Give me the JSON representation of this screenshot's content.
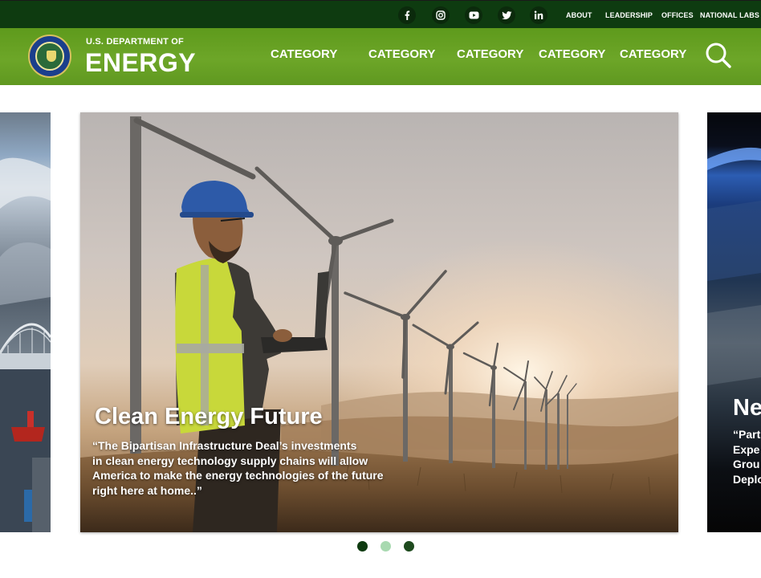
{
  "topbar": {
    "social": [
      {
        "name": "facebook-icon",
        "label": "f"
      },
      {
        "name": "instagram-icon",
        "label": ""
      },
      {
        "name": "youtube-icon",
        "label": ""
      },
      {
        "name": "twitter-icon",
        "label": ""
      },
      {
        "name": "linkedin-icon",
        "label": "in"
      }
    ],
    "links": [
      "ABOUT",
      "LEADERSHIP",
      "OFFICES",
      "NATIONAL LABS"
    ]
  },
  "header": {
    "brand_small": "U.S. DEPARTMENT OF",
    "brand_big": "ENERGY",
    "nav": [
      "CATEGORY",
      "CATEGORY",
      "CATEGORY",
      "CATEGORY",
      "CATEGORY"
    ]
  },
  "carousel": {
    "main": {
      "title": "Clean Energy Future",
      "quote_lines": [
        "“The Bipartisan Infrastructure Deal’s investments",
        " in clean energy technology supply chains will allow",
        "America to make the energy technologies of the future",
        " right here at home..”"
      ]
    },
    "next_peek": {
      "title": "Ne",
      "lines": [
        "“Part",
        "Expe",
        "Grou",
        "Deplo"
      ]
    },
    "dots": [
      {
        "active": true,
        "color": "#0e3b10"
      },
      {
        "active": false,
        "color": "#a8d9b0"
      },
      {
        "active": false,
        "color": "#1e4a1e"
      }
    ]
  },
  "colors": {
    "topbar": "#0e3b10",
    "header": "#6da628",
    "text": "#ffffff"
  }
}
